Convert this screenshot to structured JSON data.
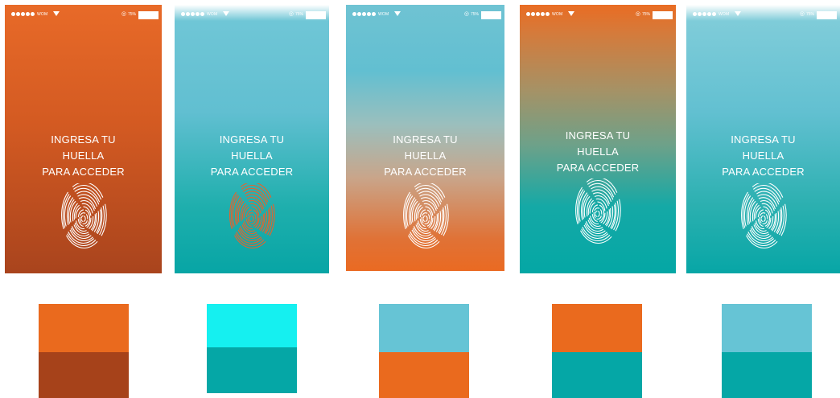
{
  "status_bar": {
    "carrier": "WOM",
    "battery_percent": "75%"
  },
  "screens": [
    {
      "prompt": [
        "INGRESA TU",
        "HUELLA",
        "PARA ACCEDER"
      ],
      "fingerprint_color": "#ffffff"
    },
    {
      "prompt": [
        "INGRESA TU",
        "HUELLA",
        "PARA ACCEDER"
      ],
      "fingerprint_color": "#e8622a"
    },
    {
      "prompt": [
        "INGRESA TU",
        "HUELLA",
        "PARA ACCEDER"
      ],
      "fingerprint_color": "#ffffff"
    },
    {
      "prompt": [
        "INGRESA TU",
        "HUELLA",
        "PARA ACCEDER"
      ],
      "fingerprint_color": "#ffffff"
    },
    {
      "prompt": [
        "INGRESA TU",
        "HUELLA",
        "PARA ACCEDER"
      ],
      "fingerprint_color": "#ffffff"
    }
  ],
  "swatches": [
    {
      "top": "#ea6a1e",
      "bottom": "#a6421a"
    },
    {
      "top": "#15f0f0",
      "bottom": "#05a7a6"
    },
    {
      "top": "#66c4d5",
      "bottom": "#ea6a1e"
    },
    {
      "top": "#ea6a1e",
      "bottom": "#05a7a6"
    },
    {
      "top": "#66c4d5",
      "bottom": "#05a7a6"
    }
  ]
}
